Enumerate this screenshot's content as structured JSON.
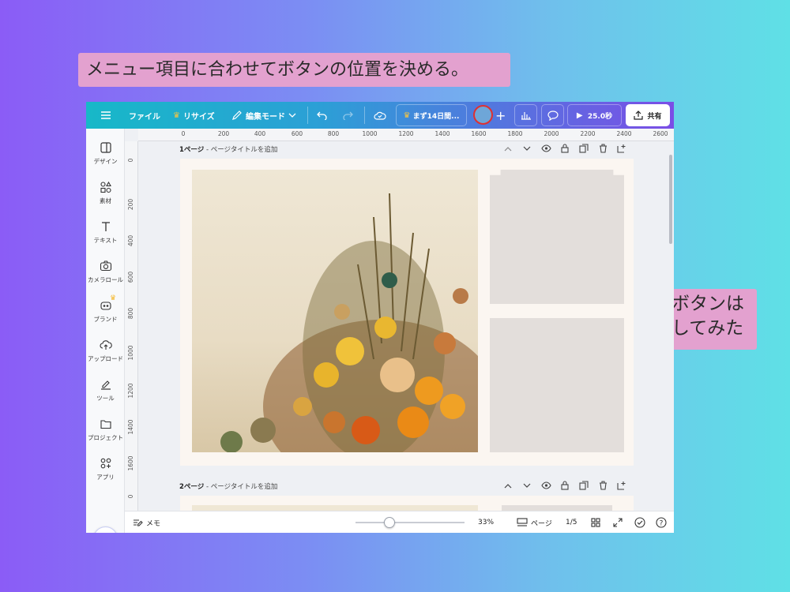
{
  "callouts": {
    "top": "メニュー項目に合わせてボタンの位置を決める。",
    "right_line1": "小さいボタンは",
    "right_line2": "図形にしてみた"
  },
  "toolbar": {
    "menu_icon": "hamburger-icon",
    "file_label": "ファイル",
    "resize_label": "リサイズ",
    "edit_mode_label": "編集モード",
    "trial_label": "まず14日間...",
    "play_time": "25.0秒",
    "share_label": "共有"
  },
  "sidebar": {
    "items": [
      {
        "label": "デザイン",
        "icon": "design-icon"
      },
      {
        "label": "素材",
        "icon": "elements-icon"
      },
      {
        "label": "テキスト",
        "icon": "text-icon"
      },
      {
        "label": "カメラロール",
        "icon": "camera-icon"
      },
      {
        "label": "ブランド",
        "icon": "brand-icon"
      },
      {
        "label": "アップロード",
        "icon": "upload-icon"
      },
      {
        "label": "ツール",
        "icon": "tools-icon"
      },
      {
        "label": "プロジェクト",
        "icon": "folder-icon"
      },
      {
        "label": "アプリ",
        "icon": "apps-icon"
      }
    ]
  },
  "ruler": {
    "h_ticks": [
      "0",
      "200",
      "400",
      "600",
      "800",
      "1000",
      "1200",
      "1400",
      "1600",
      "1800",
      "2000",
      "2200",
      "2400",
      "2600"
    ],
    "v_ticks": [
      "0",
      "200",
      "400",
      "600",
      "800",
      "1000",
      "1200",
      "1400",
      "1600",
      "0"
    ]
  },
  "pages": [
    {
      "number": "1ページ",
      "title_placeholder": " - ページタイトルを追加"
    },
    {
      "number": "2ページ",
      "title_placeholder": " - ページタイトルを追加"
    }
  ],
  "bottombar": {
    "notes_label": "メモ",
    "zoom": "33%",
    "pages_label": "ページ",
    "page_counter": "1/5",
    "zoom_level_fraction": 0.33
  },
  "colors": {
    "photo_bg": "#ece3cf",
    "frame": "#e3dedb",
    "page": "#fbf6f1"
  }
}
